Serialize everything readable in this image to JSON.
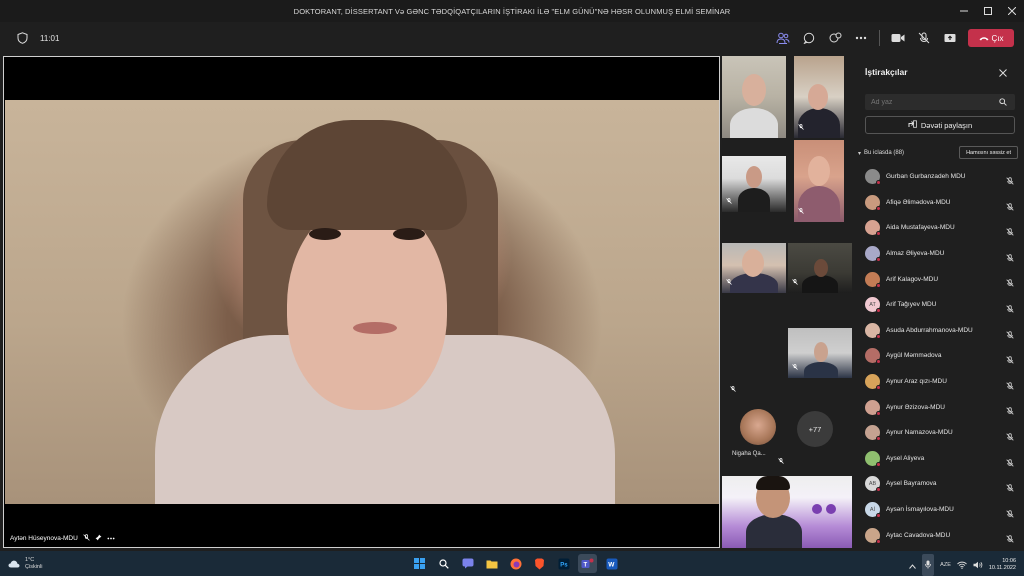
{
  "window": {
    "title": "DOKTORANT, DİSSERTANT Və GƏNC TƏDQİQATÇILARIN İŞTİRAKI İLƏ \"ELM GÜNÜ\"NƏ HƏSR OLUNMUŞ ELMİ SEMİNAR"
  },
  "toolbar": {
    "meeting_time": "11:01",
    "leave_label": "Çıx"
  },
  "main_video": {
    "speaker_name": "Aytən Hüseynova-MDU"
  },
  "gallery": {
    "named_tile": "Nigaha Qa...",
    "overflow_count": "+77"
  },
  "panel": {
    "title": "İştirakçılar",
    "search_placeholder": "Ad yaz",
    "share_invite": "Dəvəti paylaşın",
    "section_label": "Bu iclasda (88)",
    "mute_all": "Hamısını səssiz et",
    "participants": [
      {
        "name": "Gurban Gurbanzadeh MDU",
        "initials": "",
        "color": "#8a8a8a"
      },
      {
        "name": "Afiqə Əlimədova-MDU",
        "initials": "",
        "color": "#c89a7e"
      },
      {
        "name": "Aida Mustafayeva-MDU",
        "initials": "",
        "color": "#d7a291"
      },
      {
        "name": "Almaz Əliyeva-MDU",
        "initials": "",
        "color": "#a8a8c8"
      },
      {
        "name": "Arif Kalagov-MDU",
        "initials": "",
        "color": "#c37c55"
      },
      {
        "name": "Arif Tağıyev MDU",
        "initials": "AT",
        "color": "#f0c8d0"
      },
      {
        "name": "Asuda Abdurrahmanova-MDU",
        "initials": "",
        "color": "#d9b6a4"
      },
      {
        "name": "Aygül Məmmədova",
        "initials": "",
        "color": "#b46d66"
      },
      {
        "name": "Aynur Araz qızı-MDU",
        "initials": "",
        "color": "#d7a35a"
      },
      {
        "name": "Aynur Əzizova-MDU",
        "initials": "",
        "color": "#cfa090"
      },
      {
        "name": "Aynur Namazova-MDU",
        "initials": "",
        "color": "#c4a291"
      },
      {
        "name": "Aysel Aliyeva",
        "initials": "",
        "color": "#8fbf6f"
      },
      {
        "name": "Aysel Bayramova",
        "initials": "AB",
        "color": "#d8d8d8"
      },
      {
        "name": "Aysən İsmayılova-MDU",
        "initials": "Aİ",
        "color": "#c8d8e8"
      },
      {
        "name": "Aytac Cavadova-MDU",
        "initials": "",
        "color": "#c9a58a"
      }
    ]
  },
  "taskbar": {
    "weather_temp": "1°C",
    "weather_desc": "Çiskinli",
    "language": "AZE",
    "time": "10:06",
    "date": "10.11.2022"
  },
  "colors": {
    "leave_button": "#c4314b",
    "taskbar_bg": "#1a2a38",
    "status_dot": "#c4314b"
  }
}
